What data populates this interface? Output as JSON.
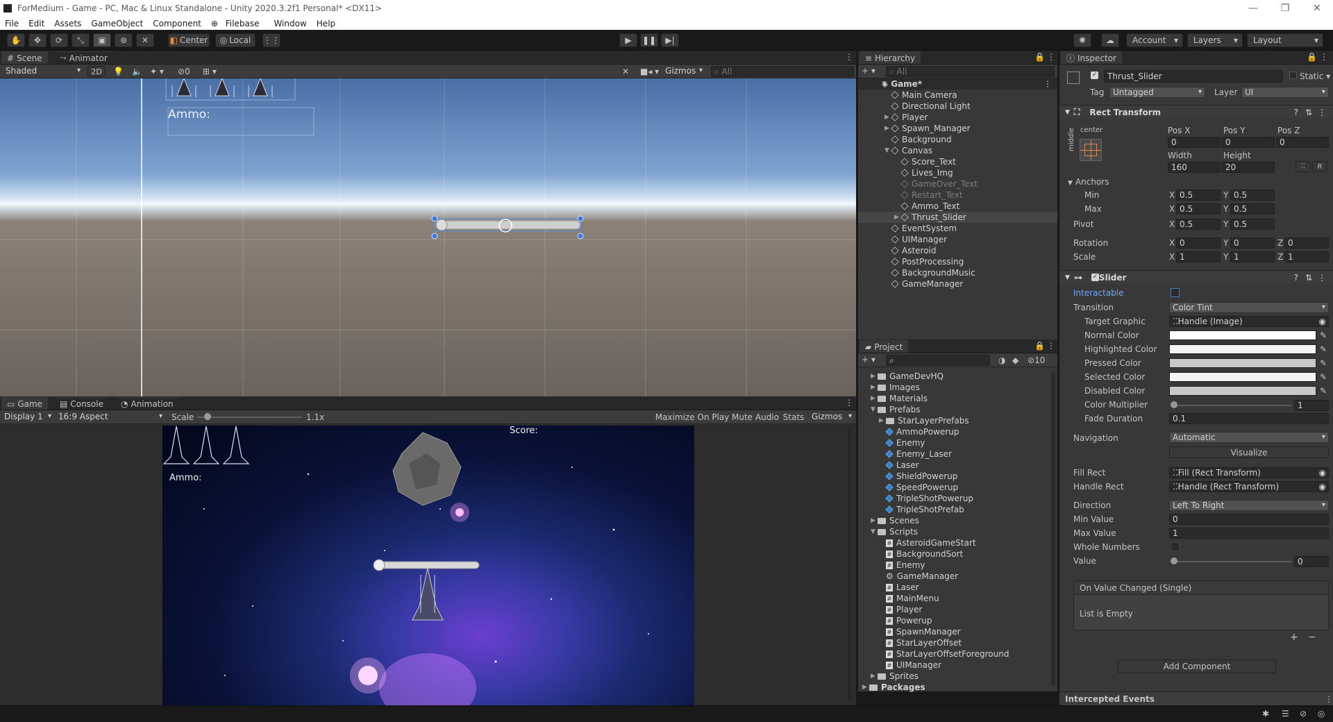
{
  "window": {
    "title": "ForMedium - Game - PC, Mac & Linux Standalone - Unity 2020.3.2f1 Personal* <DX11>"
  },
  "menu": [
    "File",
    "Edit",
    "Assets",
    "GameObject",
    "Component",
    "Filebase",
    "Window",
    "Help"
  ],
  "toolbar": {
    "center": "Center",
    "local": "Local",
    "account": "Account",
    "layers": "Layers",
    "layout": "Layout"
  },
  "scene": {
    "tab_scene": "Scene",
    "tab_animator": "Animator",
    "shading": "Shaded",
    "mode_2d": "2D",
    "hidden_count": "0",
    "gizmos": "Gizmos",
    "search_placeholder": "All",
    "ammo_label": "Ammo:"
  },
  "game": {
    "tab_game": "Game",
    "tab_console": "Console",
    "tab_animation": "Animation",
    "display": "Display 1",
    "aspect": "16:9 Aspect",
    "scale_label": "Scale",
    "scale_value": "1.1x",
    "maximize": "Maximize On Play",
    "mute": "Mute Audio",
    "stats": "Stats",
    "gizmos": "Gizmos",
    "score": "Score:",
    "ammo": "Ammo:"
  },
  "hierarchy": {
    "title": "Hierarchy",
    "search_placeholder": "All",
    "root": "Game*",
    "items": [
      {
        "name": "Main Camera",
        "depth": 1,
        "arrow": "",
        "dim": false
      },
      {
        "name": "Directional Light",
        "depth": 1,
        "arrow": "",
        "dim": false
      },
      {
        "name": "Player",
        "depth": 1,
        "arrow": "▶",
        "dim": false
      },
      {
        "name": "Spawn_Manager",
        "depth": 1,
        "arrow": "▶",
        "dim": false
      },
      {
        "name": "Background",
        "depth": 1,
        "arrow": "",
        "dim": false
      },
      {
        "name": "Canvas",
        "depth": 1,
        "arrow": "▼",
        "dim": false
      },
      {
        "name": "Score_Text",
        "depth": 2,
        "arrow": "",
        "dim": false
      },
      {
        "name": "Lives_Img",
        "depth": 2,
        "arrow": "",
        "dim": false
      },
      {
        "name": "GameOver_Text",
        "depth": 2,
        "arrow": "",
        "dim": true
      },
      {
        "name": "Restart_Text",
        "depth": 2,
        "arrow": "",
        "dim": true
      },
      {
        "name": "Ammo_Text",
        "depth": 2,
        "arrow": "",
        "dim": false
      },
      {
        "name": "Thrust_Slider",
        "depth": 2,
        "arrow": "▶",
        "dim": false,
        "selected": true
      },
      {
        "name": "EventSystem",
        "depth": 1,
        "arrow": "",
        "dim": false
      },
      {
        "name": "UIManager",
        "depth": 1,
        "arrow": "",
        "dim": false
      },
      {
        "name": "Asteroid",
        "depth": 1,
        "arrow": "",
        "dim": false
      },
      {
        "name": "PostProcessing",
        "depth": 1,
        "arrow": "",
        "dim": false
      },
      {
        "name": "BackgroundMusic",
        "depth": 1,
        "arrow": "",
        "dim": false
      },
      {
        "name": "GameManager",
        "depth": 1,
        "arrow": "",
        "dim": false
      }
    ]
  },
  "project": {
    "title": "Project",
    "hidden_count": "10",
    "items": [
      {
        "name": "GameDevHQ",
        "depth": 1,
        "arrow": "▶",
        "type": "folder"
      },
      {
        "name": "Images",
        "depth": 1,
        "arrow": "▶",
        "type": "folder"
      },
      {
        "name": "Materials",
        "depth": 1,
        "arrow": "▶",
        "type": "folder"
      },
      {
        "name": "Prefabs",
        "depth": 1,
        "arrow": "▼",
        "type": "folder"
      },
      {
        "name": "StarLayerPrefabs",
        "depth": 2,
        "arrow": "▶",
        "type": "folder"
      },
      {
        "name": "AmmoPowerup",
        "depth": 2,
        "arrow": "",
        "type": "prefab"
      },
      {
        "name": "Enemy",
        "depth": 2,
        "arrow": "",
        "type": "prefab"
      },
      {
        "name": "Enemy_Laser",
        "depth": 2,
        "arrow": "",
        "type": "prefab"
      },
      {
        "name": "Laser",
        "depth": 2,
        "arrow": "",
        "type": "prefab"
      },
      {
        "name": "ShieldPowerup",
        "depth": 2,
        "arrow": "",
        "type": "prefab"
      },
      {
        "name": "SpeedPowerup",
        "depth": 2,
        "arrow": "",
        "type": "prefab"
      },
      {
        "name": "TripleShotPowerup",
        "depth": 2,
        "arrow": "",
        "type": "prefab"
      },
      {
        "name": "TripleShotPrefab",
        "depth": 2,
        "arrow": "",
        "type": "prefab"
      },
      {
        "name": "Scenes",
        "depth": 1,
        "arrow": "▶",
        "type": "folder"
      },
      {
        "name": "Scripts",
        "depth": 1,
        "arrow": "▼",
        "type": "folder"
      },
      {
        "name": "AsteroidGameStart",
        "depth": 2,
        "arrow": "",
        "type": "script"
      },
      {
        "name": "BackgroundSort",
        "depth": 2,
        "arrow": "",
        "type": "script"
      },
      {
        "name": "Enemy",
        "depth": 2,
        "arrow": "",
        "type": "script"
      },
      {
        "name": "GameManager",
        "depth": 2,
        "arrow": "",
        "type": "gear"
      },
      {
        "name": "Laser",
        "depth": 2,
        "arrow": "",
        "type": "script"
      },
      {
        "name": "MainMenu",
        "depth": 2,
        "arrow": "",
        "type": "script"
      },
      {
        "name": "Player",
        "depth": 2,
        "arrow": "",
        "type": "script"
      },
      {
        "name": "Powerup",
        "depth": 2,
        "arrow": "",
        "type": "script"
      },
      {
        "name": "SpawnManager",
        "depth": 2,
        "arrow": "",
        "type": "script"
      },
      {
        "name": "StarLayerOffset",
        "depth": 2,
        "arrow": "",
        "type": "script"
      },
      {
        "name": "StarLayerOffsetForeground",
        "depth": 2,
        "arrow": "",
        "type": "script"
      },
      {
        "name": "UIManager",
        "depth": 2,
        "arrow": "",
        "type": "script"
      },
      {
        "name": "Sprites",
        "depth": 1,
        "arrow": "▶",
        "type": "folder"
      },
      {
        "name": "Packages",
        "depth": 0,
        "arrow": "▶",
        "type": "folder"
      }
    ]
  },
  "inspector": {
    "title": "Inspector",
    "object_name": "Thrust_Slider",
    "static": "Static",
    "tag_label": "Tag",
    "tag": "Untagged",
    "layer_label": "Layer",
    "layer": "UI",
    "rect": {
      "title": "Rect Transform",
      "anchor_preset": "center",
      "anchor_side": "middle",
      "posx_label": "Pos X",
      "posy_label": "Pos Y",
      "posz_label": "Pos Z",
      "posx": "0",
      "posy": "0",
      "posz": "0",
      "width_label": "Width",
      "height_label": "Height",
      "width": "160",
      "height": "20",
      "raw": "R",
      "anchors": "Anchors",
      "min": "Min",
      "max": "Max",
      "pivot": "Pivot",
      "rotation": "Rotation",
      "scale": "Scale",
      "min_x": "0.5",
      "min_y": "0.5",
      "max_x": "0.5",
      "max_y": "0.5",
      "pivot_x": "0.5",
      "pivot_y": "0.5",
      "rot_x": "0",
      "rot_y": "0",
      "rot_z": "0",
      "scale_x": "1",
      "scale_y": "1",
      "scale_z": "1",
      "x": "X",
      "y": "Y",
      "z": "Z"
    },
    "slider": {
      "title": "Slider",
      "interactable": "Interactable",
      "transition": "Transition",
      "transition_value": "Color Tint",
      "target_graphic": "Target Graphic",
      "target_graphic_value": "Handle (Image)",
      "normal": "Normal Color",
      "highlighted": "Highlighted Color",
      "pressed": "Pressed Color",
      "selected": "Selected Color",
      "disabled": "Disabled Color",
      "normal_color": "#ffffff",
      "highlighted_color": "#f5f5f5",
      "pressed_color": "#c8c8c8",
      "selected_color": "#f5f5f5",
      "disabled_color": "#c8c8c8",
      "multiplier": "Color Multiplier",
      "multiplier_value": "1",
      "fade": "Fade Duration",
      "fade_value": "0.1",
      "navigation": "Navigation",
      "navigation_value": "Automatic",
      "visualize": "Visualize",
      "fill_rect": "Fill Rect",
      "fill_rect_value": "Fill (Rect Transform)",
      "handle_rect": "Handle Rect",
      "handle_rect_value": "Handle (Rect Transform)",
      "direction": "Direction",
      "direction_value": "Left To Right",
      "min_value": "Min Value",
      "min_value_value": "0",
      "max_value": "Max Value",
      "max_value_value": "1",
      "whole": "Whole Numbers",
      "value": "Value",
      "value_value": "0",
      "event": "On Value Changed (Single)",
      "empty": "List is Empty"
    },
    "add_component": "Add Component",
    "intercepted": "Intercepted Events"
  }
}
